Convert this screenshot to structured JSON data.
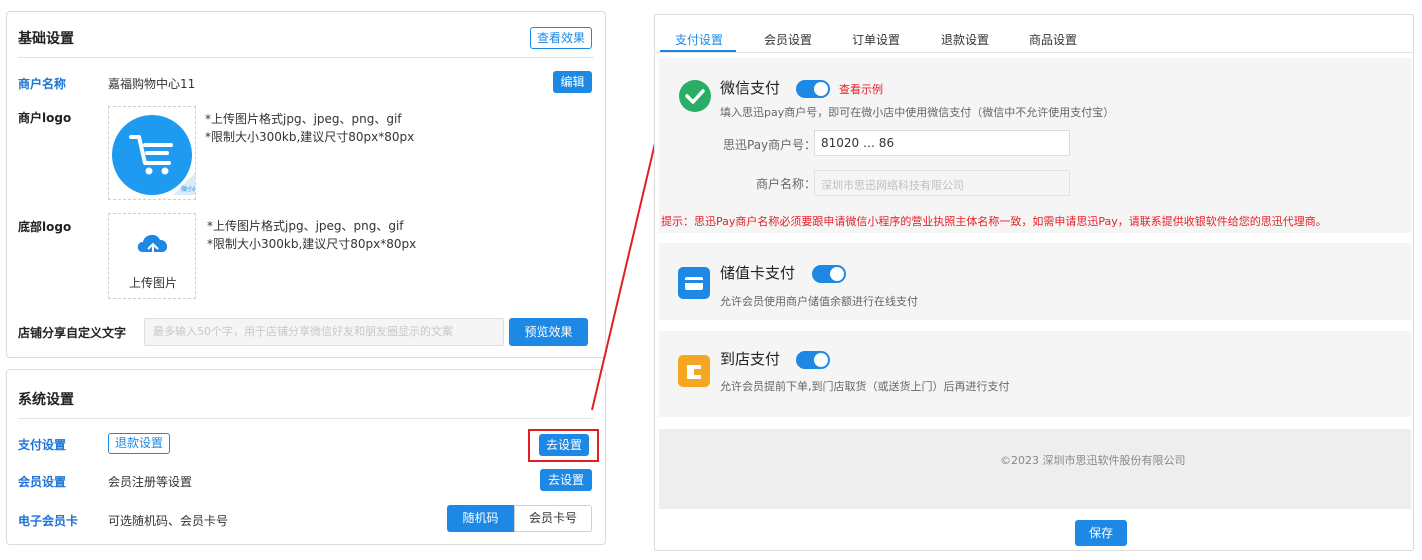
{
  "basic": {
    "title": "基础设置",
    "preview_btn": "查看效果",
    "merchant_label": "商户名称",
    "merchant_value": "嘉福购物中心11",
    "edit_btn": "编辑",
    "logo_label": "商户logo",
    "logo_badge": "微小店",
    "logo_hint1": "*上传图片格式jpg、jpeg、png、gif",
    "logo_hint2": "*限制大小300kb,建议尺寸80px*80px",
    "bottom_logo_label": "底部logo",
    "upload_text": "上传图片",
    "bottom_hint1": "*上传图片格式jpg、jpeg、png、gif",
    "bottom_hint2": "*限制大小300kb,建议尺寸80px*80px",
    "share_label": "店铺分享自定义文字",
    "share_placeholder": "最多输入50个字，用于店铺分享微信好友和朋友圈显示的文案",
    "share_preview_btn": "预览效果"
  },
  "system": {
    "title": "系统设置",
    "pay_label": "支付设置",
    "refund_tag": "退款设置",
    "pay_btn": "去设置",
    "member_label": "会员设置",
    "member_desc": "会员注册等设置",
    "member_btn": "去设置",
    "card_label": "电子会员卡",
    "card_desc": "可选随机码、会员卡号",
    "card_opt1": "随机码",
    "card_opt2": "会员卡号"
  },
  "right": {
    "tabs": [
      "支付设置",
      "会员设置",
      "订单设置",
      "退款设置",
      "商品设置"
    ],
    "wechat": {
      "title": "微信支付",
      "example_link": "查看示例",
      "desc": "填入思迅pay商户号，即可在微小店中使用微信支付（微信中不允许使用支付宝）",
      "id_label": "思迅Pay商户号：",
      "id_value": "81020 … 86",
      "name_label": "商户名称：",
      "name_value": "深圳市思迅网络科技有限公司",
      "tip": "提示：思迅Pay商户名称必须要跟申请微信小程序的营业执照主体名称一致，如需申请思迅Pay，请联系提供收银软件给您的思迅代理商。"
    },
    "card": {
      "title": "储值卡支付",
      "desc": "允许会员使用商户储值余额进行在线支付"
    },
    "store": {
      "title": "到店支付",
      "desc": "允许会员提前下单,到门店取货（或送货上门）后再进行支付"
    },
    "footer": "©2023 深圳市思迅软件股份有限公司",
    "save_btn": "保存"
  },
  "colors": {
    "accent": "#1e88e5",
    "label_blue": "#1e74d6",
    "wechat_green": "#2aae67",
    "card_blue": "#1e88e5",
    "store_orange": "#f5a623",
    "tip_red": "#e8202a",
    "highlight_red": "#e02020"
  }
}
